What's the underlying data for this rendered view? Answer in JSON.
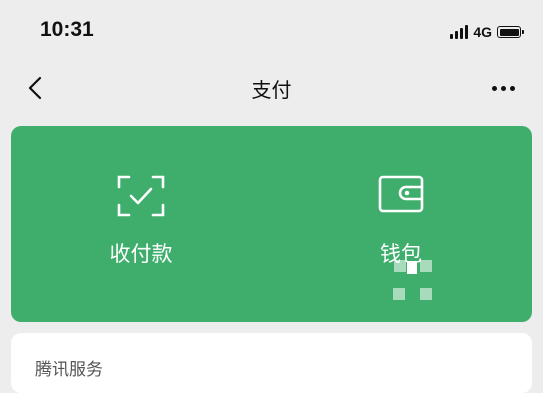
{
  "status_bar": {
    "time": "10:31",
    "network": "4G",
    "battery_level": 1.0
  },
  "nav": {
    "title": "支付",
    "back_icon": "chevron-left-icon",
    "more_icon": "more-horizontal-icon"
  },
  "actions": [
    {
      "label": "收付款",
      "icon": "scan-check-icon"
    },
    {
      "label": "钱包",
      "icon": "wallet-icon"
    }
  ],
  "services": {
    "title": "腾讯服务"
  },
  "colors": {
    "accent": "#3fae6c",
    "background": "#ededed",
    "card": "#ffffff"
  }
}
